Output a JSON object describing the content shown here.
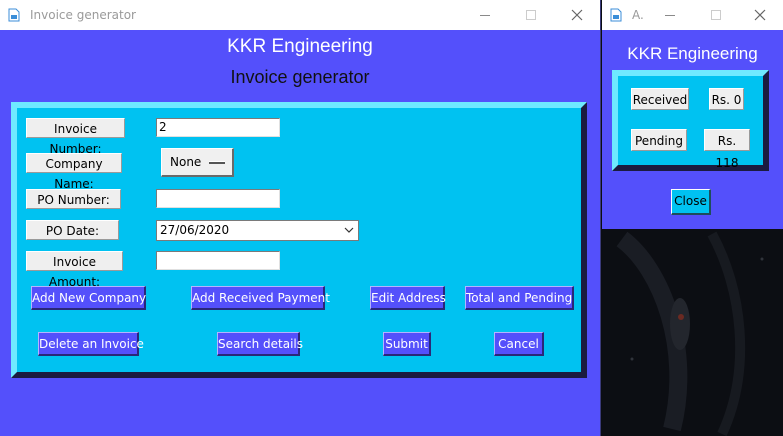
{
  "main_window": {
    "title": "Invoice generator",
    "heading": "KKR Engineering",
    "subheading": "Invoice generator",
    "form": {
      "invoice_number_label": "Invoice Number:",
      "invoice_number_value": "2",
      "company_name_label": "Company Name:",
      "company_name_selected": "None",
      "po_number_label": "PO Number:",
      "po_number_value": "",
      "po_date_label": "PO Date:",
      "po_date_value": "27/06/2020",
      "invoice_amount_label": "Invoice Amount:",
      "invoice_amount_value": ""
    },
    "buttons": {
      "add_new_company": "Add New Company",
      "add_received_payment": "Add Received Payment",
      "edit_address": "Edit Address",
      "total_and_pending": "Total and Pending",
      "delete_invoice": "Delete an Invoice",
      "search_details": "Search details",
      "submit": "Submit",
      "cancel": "Cancel"
    }
  },
  "side_window": {
    "title": "A.",
    "heading": "KKR Engineering",
    "received_label": "Received",
    "received_value": "Rs. 0",
    "pending_label": "Pending",
    "pending_value": "Rs. 118",
    "close_label": "Close"
  },
  "colors": {
    "window_bg": "#5450fb",
    "panel_bg": "#00c2f1",
    "label_bg": "#efefef",
    "button_text": "#ffffff"
  },
  "icons": [
    "app-icon",
    "minimize-icon",
    "maximize-icon",
    "close-icon",
    "dropdown-arrow-icon",
    "option-menu-indicator-icon"
  ]
}
